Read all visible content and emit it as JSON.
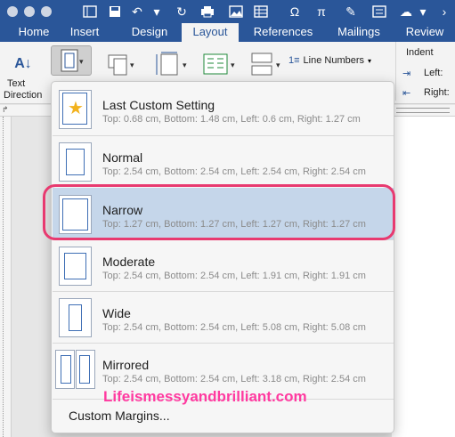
{
  "ribbon_tabs": [
    "Home",
    "Insert",
    "Design",
    "Layout",
    "References",
    "Mailings",
    "Review"
  ],
  "active_tab": "Layout",
  "ribbon": {
    "text_direction_line1": "Text",
    "text_direction_line2": "Direction",
    "line_numbers": "Line Numbers",
    "indent": "Indent",
    "left_label": "Left:",
    "right_label": "Right:"
  },
  "margins_menu": [
    {
      "title": "Last Custom Setting",
      "desc": "Top: 0.68 cm, Bottom: 1.48 cm, Left: 0.6 cm, Right: 1.27 cm"
    },
    {
      "title": "Normal",
      "desc": "Top: 2.54 cm, Bottom: 2.54 cm, Left: 2.54 cm, Right: 2.54 cm"
    },
    {
      "title": "Narrow",
      "desc": "Top: 1.27 cm, Bottom: 1.27 cm, Left: 1.27 cm, Right: 1.27 cm"
    },
    {
      "title": "Moderate",
      "desc": "Top: 2.54 cm, Bottom: 2.54 cm, Left: 1.91 cm, Right: 1.91 cm"
    },
    {
      "title": "Wide",
      "desc": "Top: 2.54 cm, Bottom: 2.54 cm, Left: 5.08 cm, Right: 5.08 cm"
    },
    {
      "title": "Mirrored",
      "desc": "Top: 2.54 cm, Bottom: 2.54 cm, Left: 3.18 cm, Right: 2.54 cm"
    }
  ],
  "selected_item": "Narrow",
  "custom_margins": "Custom Margins...",
  "watermark": "Lifeismessyandbrilliant.com",
  "colors": {
    "titlebar": "#2a5699",
    "selected_row": "#c5d6ea",
    "highlight_ring": "#e83a70",
    "watermark": "#ff3aa0"
  }
}
